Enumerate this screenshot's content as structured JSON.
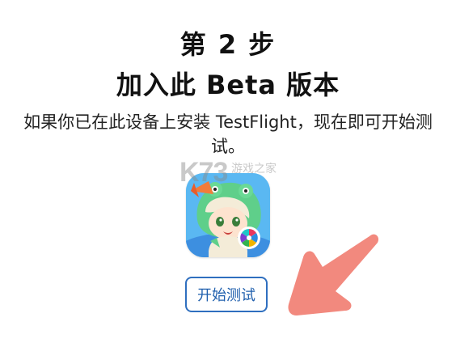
{
  "step": {
    "title": "第 2 步",
    "subtitle": "加入此 Beta 版本"
  },
  "description": {
    "line1": "如果你已在此设备上安装 TestFlight，现在即可开始测",
    "line2": "试。"
  },
  "watermark": {
    "logo": "K73",
    "text": "游戏之家"
  },
  "start_button": {
    "label": "开始测试"
  },
  "colors": {
    "button_border": "#2f6fbf",
    "button_text": "#1f5fad",
    "arrow": "#f2897e"
  },
  "icons": {
    "app_icon": "game-character-app-icon",
    "arrow": "pointing-arrow-icon"
  }
}
